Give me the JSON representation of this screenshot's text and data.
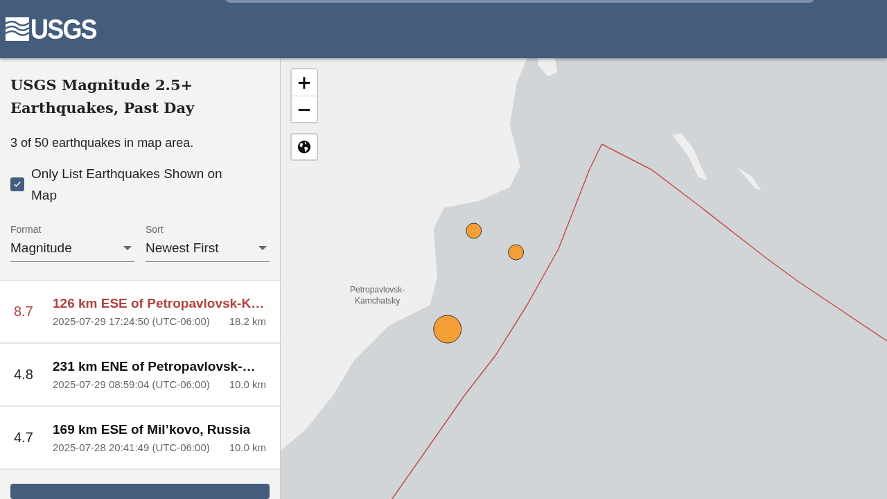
{
  "header": {
    "logo": "USGS"
  },
  "sidebar": {
    "title": "USGS Magnitude 2.5+ Earthquakes, Past Day",
    "count": "3 of 50 earthquakes in map area.",
    "only_list_shown": {
      "label": "Only List Earthquakes Shown on Map",
      "checked": true
    },
    "format": {
      "label": "Format",
      "value": "Magnitude"
    },
    "sort": {
      "label": "Sort",
      "value": "Newest First"
    }
  },
  "earthquakes": [
    {
      "magnitude": "8.7",
      "place": "126 km ESE of Petropavlovsk-K…",
      "time": "2025-07-29 17:24:50 (UTC-06:00)",
      "depth": "18.2 km",
      "selected": true
    },
    {
      "magnitude": "4.8",
      "place": "231 km ENE of Petropavlovsk-…",
      "time": "2025-07-29 08:59:04 (UTC-06:00)",
      "depth": "10.0 km",
      "selected": false
    },
    {
      "magnitude": "4.7",
      "place": "169 km ESE of Mil’kovo, Russia",
      "time": "2025-07-28 20:41:49 (UTC-06:00)",
      "depth": "10.0 km",
      "selected": false
    }
  ],
  "map": {
    "zoom_in": "+",
    "zoom_out": "−",
    "city_label": "Petropavlovsk-\nKamchatsky"
  }
}
